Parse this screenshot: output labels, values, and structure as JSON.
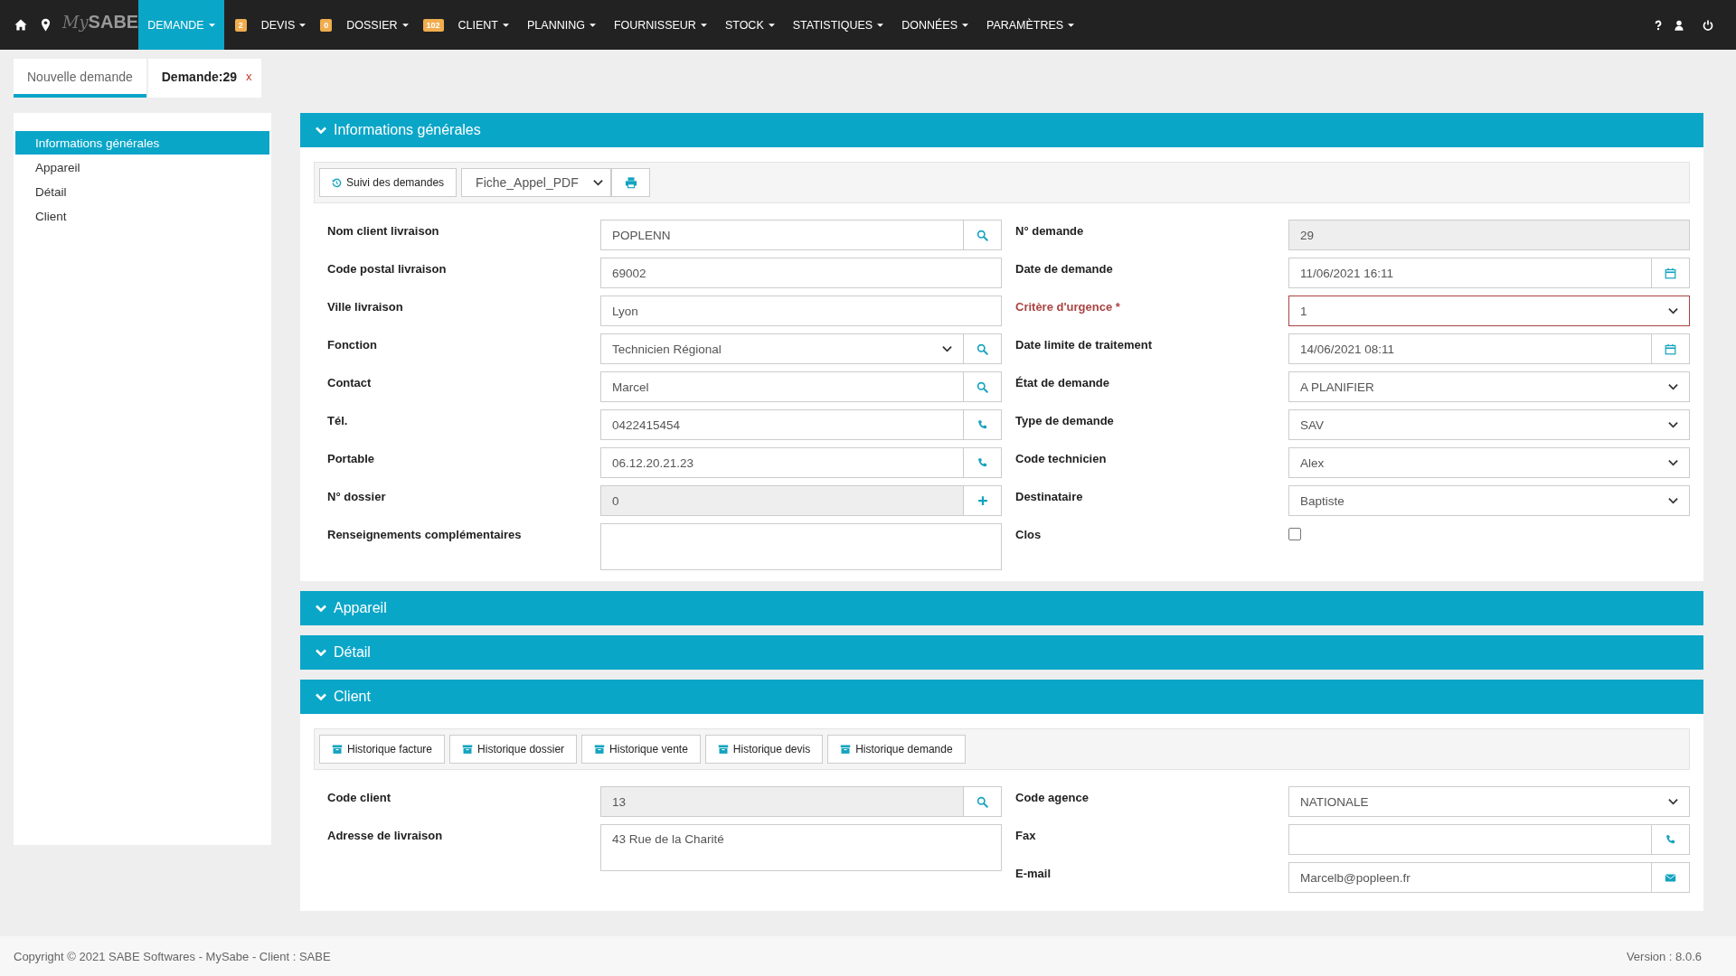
{
  "navbar": {
    "logo": {
      "script": "My",
      "word": "SABE"
    },
    "items": [
      {
        "label": "DEMANDE",
        "selected": true,
        "badge": "2"
      },
      {
        "label": "DEVIS",
        "selected": false,
        "badge": "0"
      },
      {
        "label": "DOSSIER",
        "selected": false,
        "badge": "102"
      },
      {
        "label": "CLIENT",
        "selected": false
      },
      {
        "label": "PLANNING",
        "selected": false
      },
      {
        "label": "FOURNISSEUR",
        "selected": false
      },
      {
        "label": "STOCK",
        "selected": false
      },
      {
        "label": "STATISTIQUES",
        "selected": false
      },
      {
        "label": "DONNÉES",
        "selected": false
      },
      {
        "label": "PARAMÈTRES",
        "selected": false
      }
    ]
  },
  "tabs": [
    {
      "label": "Nouvelle demande",
      "selected": true
    },
    {
      "label": "Demande:29",
      "selected": false,
      "close": "x"
    }
  ],
  "sidebar": {
    "items": [
      {
        "label": "Informations générales",
        "selected": true
      },
      {
        "label": "Appareil",
        "selected": false
      },
      {
        "label": "Détail",
        "selected": false
      },
      {
        "label": "Client",
        "selected": false
      }
    ]
  },
  "sections": [
    {
      "title": "Informations générales",
      "expanded": true,
      "toolbar": [
        {
          "kind": "history",
          "label": "Suivi des demandes"
        },
        {
          "kind": "select",
          "value": "Fiche_Appel_PDF"
        },
        {
          "kind": "print"
        }
      ],
      "left": [
        {
          "label": "Nom client livraison",
          "kind": "lookup",
          "value": "POPLENN"
        },
        {
          "label": "Code postal livraison",
          "kind": "text",
          "value": "69002"
        },
        {
          "label": "Ville livraison",
          "kind": "text",
          "value": "Lyon"
        },
        {
          "label": "Fonction",
          "kind": "picker",
          "value": "Technicien Régional"
        },
        {
          "label": "Contact",
          "kind": "lookup",
          "value": "Marcel"
        },
        {
          "label": "Tél.",
          "kind": "phone",
          "value": "0422415454"
        },
        {
          "label": "Portable",
          "kind": "phone",
          "value": "06.12.20.21.23"
        },
        {
          "label": "N° dossier",
          "kind": "addable",
          "value": "0",
          "readonly": true
        },
        {
          "label": "Renseignements complémentaires",
          "kind": "textarea"
        }
      ],
      "right": [
        {
          "label": "N° demande",
          "kind": "text",
          "value": "29",
          "readonly": true
        },
        {
          "label": "Date de demande",
          "kind": "date",
          "value": "11/06/2021 16:11"
        },
        {
          "label": "Critère d'urgence *",
          "kind": "select",
          "value": "1",
          "invalid": true
        },
        {
          "label": "Date limite de traitement",
          "kind": "date",
          "value": "14/06/2021 08:11"
        },
        {
          "label": "État de demande",
          "kind": "select",
          "value": "A PLANIFIER"
        },
        {
          "label": "Type de demande",
          "kind": "select",
          "value": "SAV"
        },
        {
          "label": "Code technicien",
          "kind": "select",
          "value": "Alex"
        },
        {
          "label": "Destinataire",
          "kind": "select",
          "value": "Baptiste"
        },
        {
          "label": "Clos",
          "kind": "checkbox",
          "checked": false
        }
      ]
    },
    {
      "title": "Appareil",
      "expanded": false
    },
    {
      "title": "Détail",
      "expanded": false
    },
    {
      "title": "Client",
      "expanded": true,
      "toolbar": [
        {
          "kind": "archive",
          "label": "Historique facture"
        },
        {
          "kind": "archive",
          "label": "Historique dossier"
        },
        {
          "kind": "archive",
          "label": "Historique vente"
        },
        {
          "kind": "archive",
          "label": "Historique devis"
        },
        {
          "kind": "archive",
          "label": "Historique demande"
        }
      ],
      "left": [
        {
          "label": "Code client",
          "kind": "lookup",
          "value": "13",
          "readonly": true
        },
        {
          "label": "Adresse de livraison",
          "kind": "textarea",
          "value": "43 Rue de la Charité"
        }
      ],
      "right": [
        {
          "label": "Code agence",
          "kind": "select",
          "value": "NATIONALE"
        },
        {
          "label": "Fax",
          "kind": "phone"
        },
        {
          "label": "E-mail",
          "kind": "email",
          "value": "Marcelb@popleen.fr"
        }
      ]
    }
  ],
  "footer": {
    "copyright": "Copyright © 2021 SABE Softwares - MySabe - Client : SABE",
    "version": "Version : 8.0.6"
  }
}
